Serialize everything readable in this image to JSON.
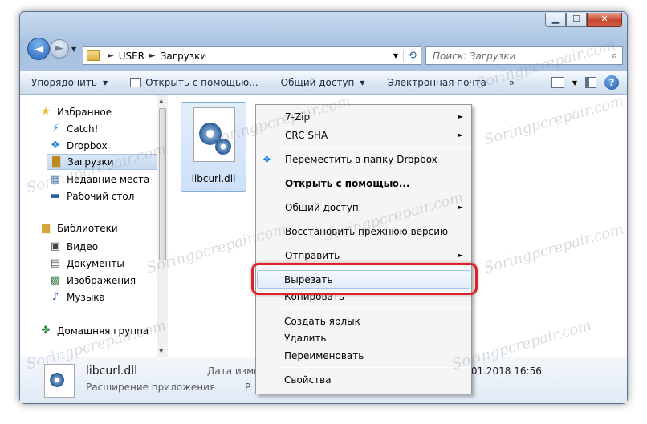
{
  "window": {
    "minimize": "▁",
    "maximize": "☐",
    "close": "✕"
  },
  "navigation": {
    "back": "◄",
    "forward": "►"
  },
  "address": {
    "segments": [
      "USER",
      "Загрузки"
    ],
    "separator": "►"
  },
  "search": {
    "placeholder": "Поиск: Загрузки"
  },
  "toolbar": {
    "organize": "Упорядочить",
    "open_with": "Открыть с помощью...",
    "share": "Общий доступ",
    "email": "Электронная почта",
    "more": "»"
  },
  "sidebar": {
    "favorites": "Избранное",
    "catch": "Catch!",
    "dropbox": "Dropbox",
    "downloads": "Загрузки",
    "recent": "Недавние места",
    "desktop": "Рабочий стол",
    "libraries": "Библиотеки",
    "video": "Видео",
    "documents": "Документы",
    "pictures": "Изображения",
    "music": "Музыка",
    "homegroup": "Домашняя группа"
  },
  "file": {
    "name": "libcurl.dll"
  },
  "details": {
    "name": "libcurl.dll",
    "type": "Расширение приложения",
    "date_label": "Дата измен",
    "size_label": "Р",
    "date_value": ".01.2018 16:56"
  },
  "context_menu": {
    "zip": "7-Zip",
    "crc": "CRC SHA",
    "move_dropbox": "Переместить в папку Dropbox",
    "open_with": "Открыть с помощью...",
    "share": "Общий доступ",
    "restore": "Восстановить прежнюю версию",
    "send_to": "Отправить",
    "cut": "Вырезать",
    "copy": "Копировать",
    "create_shortcut": "Создать ярлык",
    "delete": "Удалить",
    "rename": "Переименовать",
    "properties": "Свойства"
  },
  "watermark": "Soringpcrepair.com",
  "colors": {
    "highlight_ring": "#d9232a",
    "selection": "#cde0f7"
  }
}
